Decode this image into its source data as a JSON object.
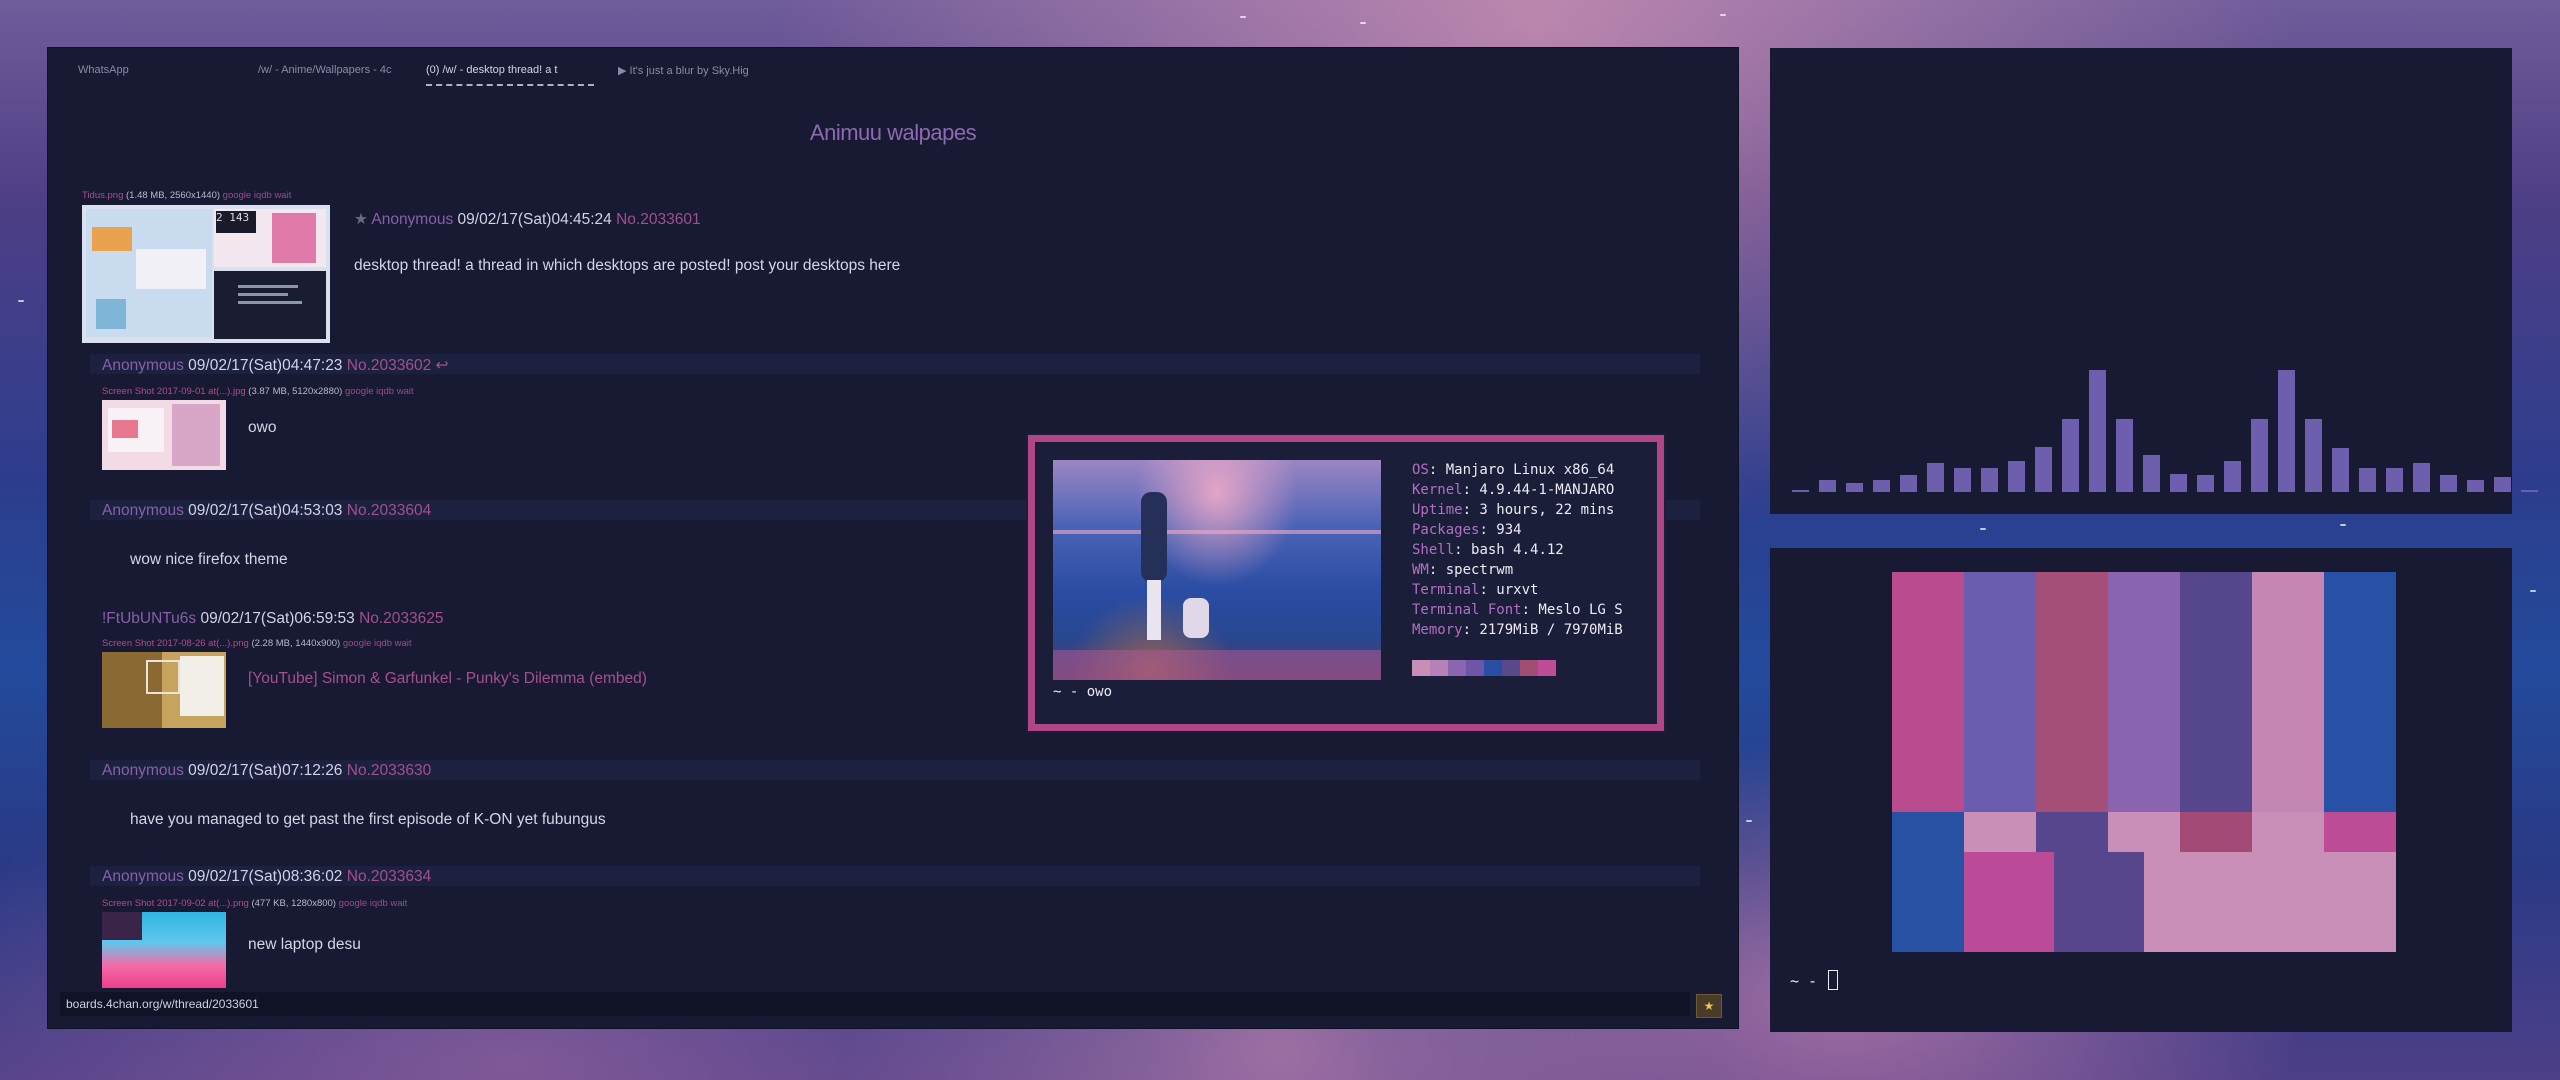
{
  "browser": {
    "tabs": [
      {
        "label": "WhatsApp"
      },
      {
        "label": "/w/ - Anime/Wallpapers - 4c"
      },
      {
        "label": "(0) /w/ - desktop thread! a t"
      },
      {
        "label": "▶ It's just a blur by Sky.Hig"
      }
    ],
    "board_title": "Animuu walpapes",
    "status_url": "boards.4chan.org/w/thread/2033601",
    "op": {
      "file_name": "Tidus.png",
      "file_meta": "(1.48 MB, 2560x1440)",
      "file_links": "google iqdb wait",
      "star": "★",
      "name": "Anonymous",
      "date": "09/02/17(Sat)04:45:24",
      "number": "No.2033601",
      "comment": "desktop thread! a thread in which desktops are posted! post your desktops here"
    },
    "replies": [
      {
        "name": "Anonymous",
        "date": "09/02/17(Sat)04:47:23",
        "number": "No.2033602",
        "arrow": "↩",
        "file_name": "Screen Shot 2017-09-01 at(...).jpg",
        "file_meta": "(3.87 MB, 5120x2880)",
        "file_links": "google iqdb wait",
        "comment": "owo"
      },
      {
        "name": "Anonymous",
        "date": "09/02/17(Sat)04:53:03",
        "number": "No.2033604",
        "comment": "wow nice firefox theme"
      },
      {
        "name": "!FtUbUNTu6s",
        "date": "09/02/17(Sat)06:59:53",
        "number": "No.2033625",
        "file_name": "Screen Shot 2017-08-26 at(...).png",
        "file_meta": "(2.28 MB, 1440x900)",
        "file_links": "google iqdb wait",
        "comment": "[YouTube] Simon & Garfunkel - Punky's Dilemma (embed)"
      },
      {
        "name": "Anonymous",
        "date": "09/02/17(Sat)07:12:26",
        "number": "No.2033630",
        "comment": "have you managed to get past the first episode of K-ON yet fubungus"
      },
      {
        "name": "Anonymous",
        "date": "09/02/17(Sat)08:36:02",
        "number": "No.2033634",
        "file_name": "Screen Shot 2017-09-02 at(...).png",
        "file_meta": "(477 KB, 1280x800)",
        "file_links": "google iqdb wait",
        "comment": "new laptop desu"
      }
    ]
  },
  "neofetch": {
    "lines": [
      {
        "key": "OS",
        "value": ": Manjaro Linux x86_64"
      },
      {
        "key": "Kernel",
        "value": ": 4.9.44-1-MANJARO"
      },
      {
        "key": "Uptime",
        "value": ": 3 hours, 22 mins"
      },
      {
        "key": "Packages",
        "value": ": 934"
      },
      {
        "key": "Shell",
        "value": ": bash 4.4.12"
      },
      {
        "key": "WM",
        "value": ": spectrwm"
      },
      {
        "key": "Terminal",
        "value": ": urxvt"
      },
      {
        "key": "Terminal Font",
        "value": ": Meslo LG S"
      },
      {
        "key": "Memory",
        "value": ": 2179MiB / 7970MiB"
      }
    ],
    "palette": [
      "#c78fb8",
      "#b482b8",
      "#8a66b0",
      "#6d56a8",
      "#2a4ea3",
      "#584a8c",
      "#a04e74",
      "#bd4d97"
    ],
    "prompt": "~ - owo"
  },
  "visualizer": {
    "levels": [
      0.02,
      0.1,
      0.07,
      0.1,
      0.14,
      0.24,
      0.2,
      0.2,
      0.25,
      0.37,
      0.6,
      1.0,
      0.6,
      0.3,
      0.15,
      0.14,
      0.25,
      0.6,
      1.0,
      0.6,
      0.36,
      0.2,
      0.2,
      0.24,
      0.14,
      0.1,
      0.12,
      0.02
    ],
    "color": "#6e5fae"
  },
  "palette_terminal": {
    "prompt": "~ -"
  }
}
